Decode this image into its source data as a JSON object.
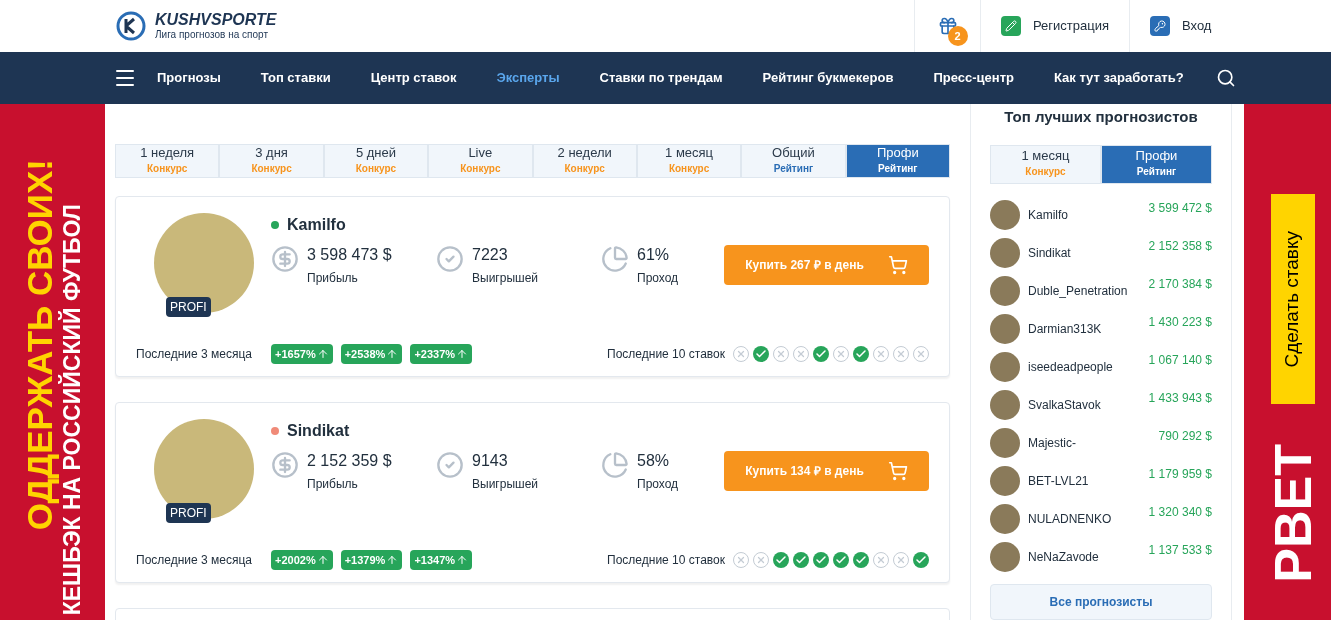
{
  "header": {
    "logo_name": "KUSHVSPORTE",
    "logo_tagline": "Лига прогнозов на спорт",
    "gift_badge": "2",
    "register": "Регистрация",
    "login": "Вход"
  },
  "nav": [
    {
      "label": "Прогнозы",
      "selected": false
    },
    {
      "label": "Топ ставки",
      "selected": false
    },
    {
      "label": "Центр ставок",
      "selected": false
    },
    {
      "label": "Эксперты",
      "selected": true
    },
    {
      "label": "Ставки по трендам",
      "selected": false
    },
    {
      "label": "Рейтинг букмекеров",
      "selected": false
    },
    {
      "label": "Пресс-центр",
      "selected": false
    },
    {
      "label": "Как тут заработать?",
      "selected": false
    }
  ],
  "left_banner": {
    "headline": "ОДДЕРЖАТЬ СВОИХ!",
    "subline": "КЕШБЭК НА РОССИЙСКИЙ ФУТБОЛ"
  },
  "right_banner": {
    "button": "Сделать ставку",
    "brand": "РВЕТ"
  },
  "period_tabs": [
    {
      "label": "1 неделя",
      "sub": "Конкурс",
      "kind": "contest",
      "selected": false
    },
    {
      "label": "3 дня",
      "sub": "Конкурс",
      "kind": "contest",
      "selected": false
    },
    {
      "label": "5 дней",
      "sub": "Конкурс",
      "kind": "contest",
      "selected": false
    },
    {
      "label": "Live",
      "sub": "Конкурс",
      "kind": "contest",
      "selected": false
    },
    {
      "label": "2 недели",
      "sub": "Конкурс",
      "kind": "contest",
      "selected": false
    },
    {
      "label": "1 месяц",
      "sub": "Конкурс",
      "kind": "contest",
      "selected": false
    },
    {
      "label": "Общий",
      "sub": "Рейтинг",
      "kind": "rating",
      "selected": false
    },
    {
      "label": "Профи",
      "sub": "Рейтинг",
      "kind": "rating",
      "selected": true
    }
  ],
  "experts": [
    {
      "name": "Kamilfo",
      "online": true,
      "badge": "PROFI",
      "profit": "3 598 473 $",
      "profit_label": "Прибыль",
      "wins": "7223",
      "wins_label": "Выигрышей",
      "pass": "61%",
      "pass_label": "Проход",
      "buy": "Купить 267 ₽ в день",
      "months_label": "Последние 3 месяца",
      "months": [
        "+1657%",
        "+2538%",
        "+2337%"
      ],
      "bets_label": "Последние 10 ставок",
      "bets": [
        false,
        true,
        false,
        false,
        true,
        false,
        true,
        false,
        false,
        false
      ]
    },
    {
      "name": "Sindikat",
      "online": false,
      "badge": "PROFI",
      "profit": "2 152 359 $",
      "profit_label": "Прибыль",
      "wins": "9143",
      "wins_label": "Выигрышей",
      "pass": "58%",
      "pass_label": "Проход",
      "buy": "Купить 134 ₽ в день",
      "months_label": "Последние 3 месяца",
      "months": [
        "+2002%",
        "+1379%",
        "+1347%"
      ],
      "bets_label": "Последние 10 ставок",
      "bets": [
        false,
        false,
        true,
        true,
        true,
        true,
        true,
        false,
        false,
        true
      ]
    }
  ],
  "sidebar": {
    "title": "Топ лучших прогнозистов",
    "tabs": [
      {
        "label": "1 месяц",
        "sub": "Конкурс",
        "kind": "contest",
        "selected": false
      },
      {
        "label": "Профи",
        "sub": "Рейтинг",
        "kind": "rating",
        "selected": true
      }
    ],
    "items": [
      {
        "name": "Kamilfo",
        "amount": "3 599 472 $"
      },
      {
        "name": "Sindikat",
        "amount": "2 152 358 $"
      },
      {
        "name": "Duble_Penetration",
        "amount": "2 170 384 $"
      },
      {
        "name": "Darmian313K",
        "amount": "1 430 223 $"
      },
      {
        "name": "iseedeadpeople",
        "amount": "1 067 140 $"
      },
      {
        "name": "SvalkaStavok",
        "amount": "1 433 943 $"
      },
      {
        "name": "Majestic-",
        "amount": "790 292 $"
      },
      {
        "name": "BET-LVL21",
        "amount": "1 179 959 $"
      },
      {
        "name": "NULADNENKO",
        "amount": "1 320 340 $"
      },
      {
        "name": "NeNaZavode",
        "amount": "1 137 533 $"
      }
    ],
    "all_button": "Все прогнозисты"
  }
}
